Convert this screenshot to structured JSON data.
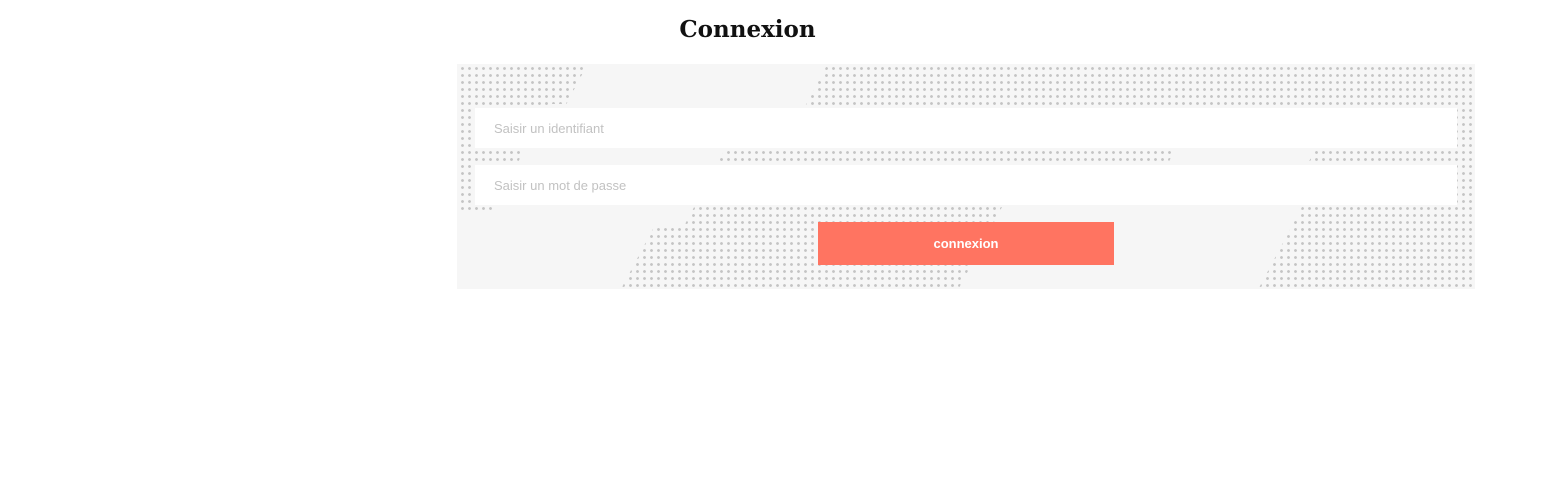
{
  "page": {
    "title": "Connexion"
  },
  "login_form": {
    "username_placeholder": "Saisir un identifiant",
    "password_placeholder": "Saisir un mot de passe",
    "submit_label": "connexion"
  },
  "colors": {
    "submit_button": "#ff7461",
    "panel_background": "#f6f6f6",
    "dot_pattern": "#c4c4c4",
    "placeholder_text": "#c2c2c2"
  }
}
